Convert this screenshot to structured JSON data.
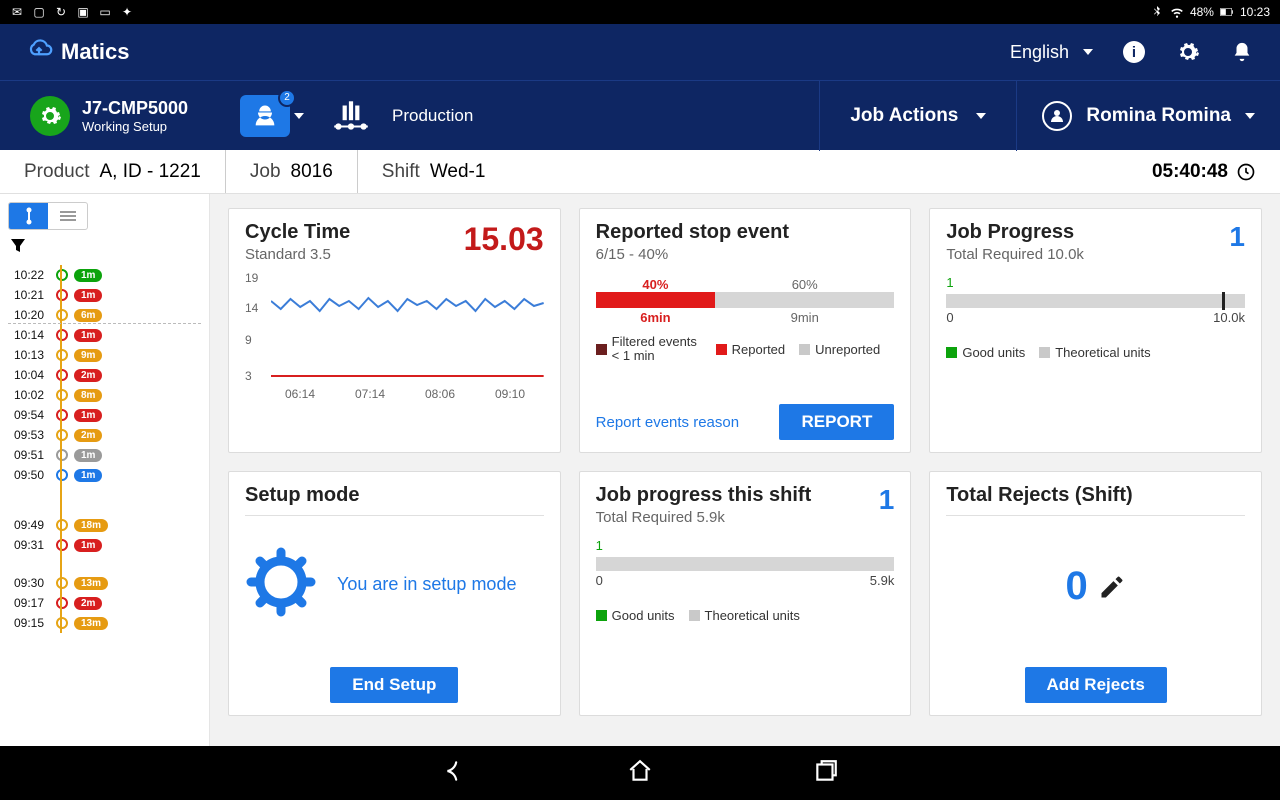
{
  "statusbar": {
    "battery": "48%",
    "time": "10:23"
  },
  "brand": "Matics",
  "lang": "English",
  "machine": {
    "name": "J7-CMP5000",
    "status": "Working Setup",
    "operatorBadge": "2",
    "mode": "Production"
  },
  "jobActionsLabel": "Job Actions",
  "user": "Romina Romina",
  "crumbs": {
    "productLabel": "Product",
    "productVal": "A, ID - 1221",
    "jobLabel": "Job",
    "jobVal": "8016",
    "shiftLabel": "Shift",
    "shiftVal": "Wed-1",
    "clock": "05:40:48"
  },
  "timeline": [
    {
      "t": "10:22",
      "dot": "#0ca30c",
      "pill": "1m",
      "cls": "green-p"
    },
    {
      "t": "10:21",
      "dot": "#d81f1f",
      "pill": "1m",
      "cls": "red-p"
    },
    {
      "t": "10:20",
      "dot": "#e6a415",
      "pill": "6m",
      "cls": "orange-p"
    },
    {
      "t": "10:14",
      "dot": "#d81f1f",
      "pill": "1m",
      "cls": "red-p"
    },
    {
      "t": "10:13",
      "dot": "#e6a415",
      "pill": "9m",
      "cls": "orange-p"
    },
    {
      "t": "10:04",
      "dot": "#d81f1f",
      "pill": "2m",
      "cls": "red-p"
    },
    {
      "t": "10:02",
      "dot": "#e6a415",
      "pill": "8m",
      "cls": "orange-p"
    },
    {
      "t": "09:54",
      "dot": "#d81f1f",
      "pill": "1m",
      "cls": "red-p"
    },
    {
      "t": "09:53",
      "dot": "#e6a415",
      "pill": "2m",
      "cls": "orange-p"
    },
    {
      "t": "09:51",
      "dot": "#9a9a9a",
      "pill": "1m",
      "cls": "gray-p"
    },
    {
      "t": "09:50",
      "dot": "#1e78e6",
      "pill": "1m",
      "cls": "blue-p"
    },
    {
      "t": "09:49",
      "dot": "#e6a415",
      "pill": "18m",
      "cls": "orange-p"
    },
    {
      "t": "09:31",
      "dot": "#d81f1f",
      "pill": "1m",
      "cls": "red-p"
    },
    {
      "t": "09:30",
      "dot": "#e6a415",
      "pill": "13m",
      "cls": "orange-p"
    },
    {
      "t": "09:17",
      "dot": "#d81f1f",
      "pill": "2m",
      "cls": "red-p"
    },
    {
      "t": "09:15",
      "dot": "#e6a415",
      "pill": "13m",
      "cls": "orange-p"
    }
  ],
  "cycle": {
    "title": "Cycle Time",
    "value": "15.03",
    "sub": "Standard 3.5",
    "yticks": [
      "19",
      "14",
      "9",
      "3"
    ],
    "xticks": [
      "06:14",
      "07:14",
      "08:06",
      "09:10"
    ]
  },
  "stopEvent": {
    "title": "Reported stop event",
    "sub": "6/15 - 40%",
    "pctReported": "40%",
    "pctUnreported": "60%",
    "timeReported": "6min",
    "timeUnreported": "9min",
    "legend": [
      "Filtered events < 1 min",
      "Reported",
      "Unreported"
    ],
    "link": "Report events reason",
    "btn": "REPORT"
  },
  "jobProgress": {
    "title": "Job Progress",
    "badge": "1",
    "sub": "Total Required 10.0k",
    "one": "1",
    "min": "0",
    "max": "10.0k",
    "legend": [
      "Good units",
      "Theoretical units"
    ]
  },
  "setup": {
    "title": "Setup mode",
    "text": "You are in setup mode",
    "btn": "End Setup"
  },
  "shiftProgress": {
    "title": "Job progress this shift",
    "badge": "1",
    "sub": "Total Required 5.9k",
    "one": "1",
    "min": "0",
    "max": "5.9k",
    "legend": [
      "Good units",
      "Theoretical units"
    ]
  },
  "rejects": {
    "title": "Total Rejects (Shift)",
    "value": "0",
    "btn": "Add Rejects"
  },
  "chart_data": {
    "type": "line",
    "title": "Cycle Time",
    "ylabel": "",
    "xlabel": "",
    "ylim": [
      3,
      19
    ],
    "x": [
      "06:14",
      "07:14",
      "08:06",
      "09:10"
    ],
    "series": [
      {
        "name": "Cycle",
        "values": [
          15,
          14.5,
          15.5,
          14.8,
          16,
          15.1,
          14.2,
          15.8,
          15.2,
          14.4,
          15.6,
          15.0,
          14.7,
          15.9,
          15.3,
          14.5,
          15.7,
          15.2,
          14.8,
          15.4,
          14.6,
          15.5,
          15.0,
          14.3,
          15.4
        ]
      }
    ],
    "standard": 3.5
  }
}
